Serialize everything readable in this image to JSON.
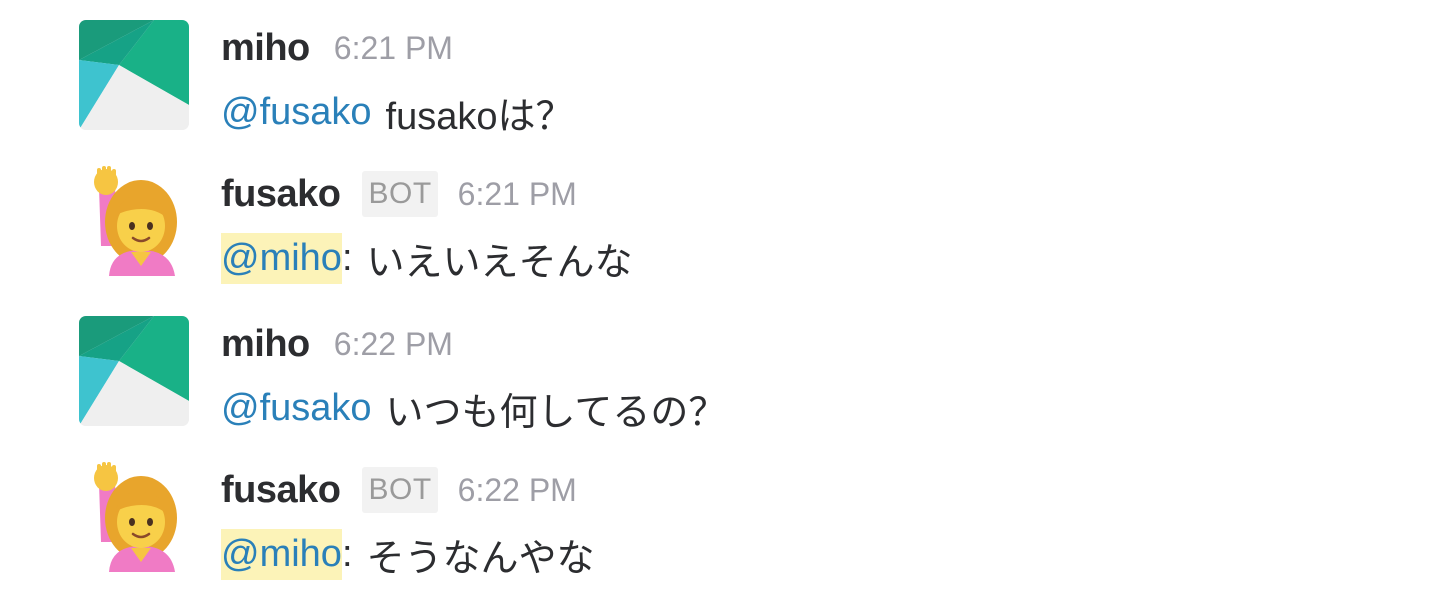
{
  "messages": [
    {
      "author": "miho",
      "bot": false,
      "time": "6:21 PM",
      "mention": "@fusako",
      "text": "fusakoは？",
      "avatar_icon": "teal-green-geometric-avatar"
    },
    {
      "author": "fusako",
      "bot": true,
      "bot_label": "BOT",
      "time": "6:21 PM",
      "mention": "@miho",
      "separator": ":",
      "text": "いえいえそんな",
      "avatar_icon": "woman-raising-hand-emoji"
    },
    {
      "author": "miho",
      "bot": false,
      "time": "6:22 PM",
      "mention": "@fusako",
      "text": "いつも何してるの？",
      "avatar_icon": "teal-green-geometric-avatar"
    },
    {
      "author": "fusako",
      "bot": true,
      "bot_label": "BOT",
      "time": "6:22 PM",
      "mention": "@miho",
      "separator": ":",
      "text": "そうなんやな",
      "avatar_icon": "woman-raising-hand-emoji"
    }
  ],
  "colors": {
    "mention": "#2a80b9",
    "mention_highlight": "#fcf3b8",
    "name": "#2c2d30",
    "timestamp": "#9e9ea6",
    "bot_badge_bg": "#f2f2f2"
  }
}
